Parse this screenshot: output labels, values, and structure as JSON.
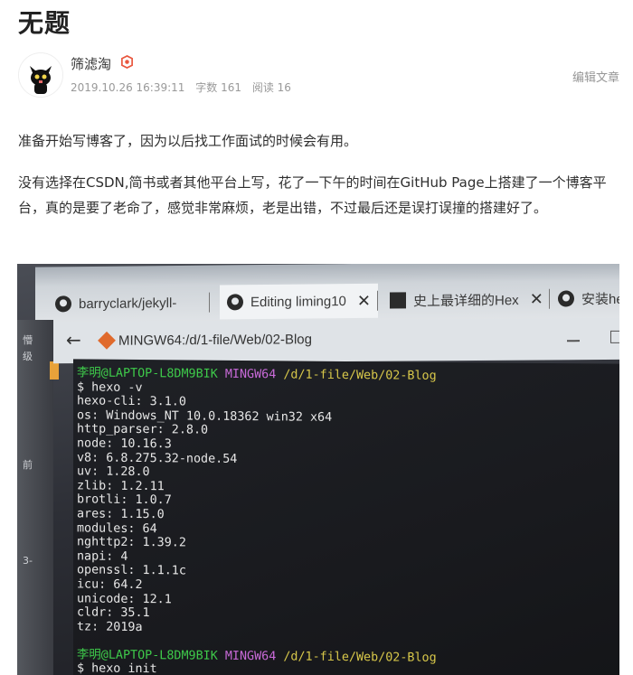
{
  "article": {
    "title": "无题",
    "author": "筛滤淘",
    "date": "2019.10.26 16:39:11",
    "word_count": "字数 161",
    "read_count": "阅读 16",
    "edit_label": "编辑文章",
    "paragraphs": [
      "准备开始写博客了，因为以后找工作面试的时候会有用。",
      "没有选择在CSDN,简书或者其他平台上写，花了一下午的时间在GitHub Page上搭建了一个博客平台，真的是要了老命了，感觉非常麻烦，老是出错，不过最后还是误打误撞的搭建好了。"
    ]
  },
  "photo": {
    "tabs": [
      {
        "label": "barryclark/jekyll-"
      },
      {
        "label": "Editing liming10"
      },
      {
        "label": "史上最详细的Hex"
      },
      {
        "label": "安装he"
      }
    ],
    "window_title": "MINGW64:/d/1-file/Web/02-Blog",
    "left_edge_text": [
      "懵",
      "级",
      "前",
      "3-"
    ],
    "prompt": {
      "user": "李明@LAPTOP-L8DM9BIK",
      "env": "MINGW64",
      "path": "/d/1-file/Web/02-Blog"
    },
    "command1": "$ hexo -v",
    "versions": [
      "hexo-cli: 3.1.0",
      "os: Windows_NT 10.0.18362 win32 x64",
      "http_parser: 2.8.0",
      "node: 10.16.3",
      "v8: 6.8.275.32-node.54",
      "uv: 1.28.0",
      "zlib: 1.2.11",
      "brotli: 1.0.7",
      "ares: 1.15.0",
      "modules: 64",
      "nghttp2: 1.39.2",
      "napi: 4",
      "openssl: 1.1.1c",
      "icu: 64.2",
      "unicode: 12.1",
      "cldr: 35.1",
      "tz: 2019a"
    ],
    "command2": "$ hexo init"
  },
  "colors": {
    "prompt_user": "#3ec94a",
    "prompt_env": "#c86ad8",
    "prompt_path": "#d8c84a",
    "badge": "#e9573f"
  }
}
